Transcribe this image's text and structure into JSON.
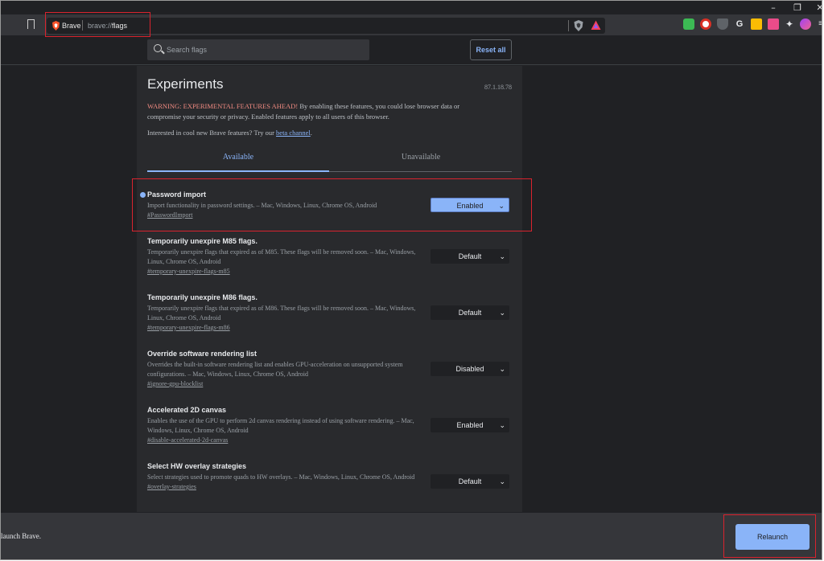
{
  "window": {
    "minimize_glyph": "–",
    "restore_glyph": "❐",
    "close_glyph": "✕"
  },
  "omnibox": {
    "site_name": "Brave",
    "url_prefix": "brave://",
    "url_path": "flags"
  },
  "search": {
    "placeholder": "Search flags"
  },
  "reset_all_label": "Reset all",
  "page": {
    "title": "Experiments",
    "version": "87.1.18.78",
    "warning_red": "WARNING: EXPERIMENTAL FEATURES AHEAD!",
    "warning_rest": " By enabling these features, you could lose browser data or compromise your security or privacy. Enabled features apply to all users of this browser.",
    "interest_text": "Interested in cool new Brave features? Try our ",
    "beta_link": "beta channel",
    "interest_end": ".",
    "tab_available": "Available",
    "tab_unavailable": "Unavailable"
  },
  "flags": [
    {
      "name": "Password import",
      "description": "Import functionality in password settings. – Mac, Windows, Linux, Chrome OS, Android",
      "link": "#PasswordImport",
      "value": "Enabled"
    },
    {
      "name": "Temporarily unexpire M85 flags.",
      "description": "Temporarily unexpire flags that expired as of M85. These flags will be removed soon. – Mac, Windows, Linux, Chrome OS, Android",
      "link": "#temporary-unexpire-flags-m85",
      "value": "Default"
    },
    {
      "name": "Temporarily unexpire M86 flags.",
      "description": "Temporarily unexpire flags that expired as of M86. These flags will be removed soon. – Mac, Windows, Linux, Chrome OS, Android",
      "link": "#temporary-unexpire-flags-m86",
      "value": "Default"
    },
    {
      "name": "Override software rendering list",
      "description": "Overrides the built-in software rendering list and enables GPU-acceleration on unsupported system configurations. – Mac, Windows, Linux, Chrome OS, Android",
      "link": "#ignore-gpu-blocklist",
      "value": "Disabled"
    },
    {
      "name": "Accelerated 2D canvas",
      "description": "Enables the use of the GPU to perform 2d canvas rendering instead of using software rendering. – Mac, Windows, Linux, Chrome OS, Android",
      "link": "#disable-accelerated-2d-canvas",
      "value": "Enabled"
    },
    {
      "name": "Select HW overlay strategies",
      "description": "Select strategies used to promote quads to HW overlays. – Mac, Windows, Linux, Chrome OS, Android",
      "link": "#overlay-strategies",
      "value": "Default"
    }
  ],
  "bottom": {
    "relaunch_text": "elaunch Brave.",
    "relaunch_button": "Relaunch"
  },
  "colors": {
    "accent": "#8ab4f8",
    "warning": "#f28b82",
    "annotation": "#d9232e"
  }
}
